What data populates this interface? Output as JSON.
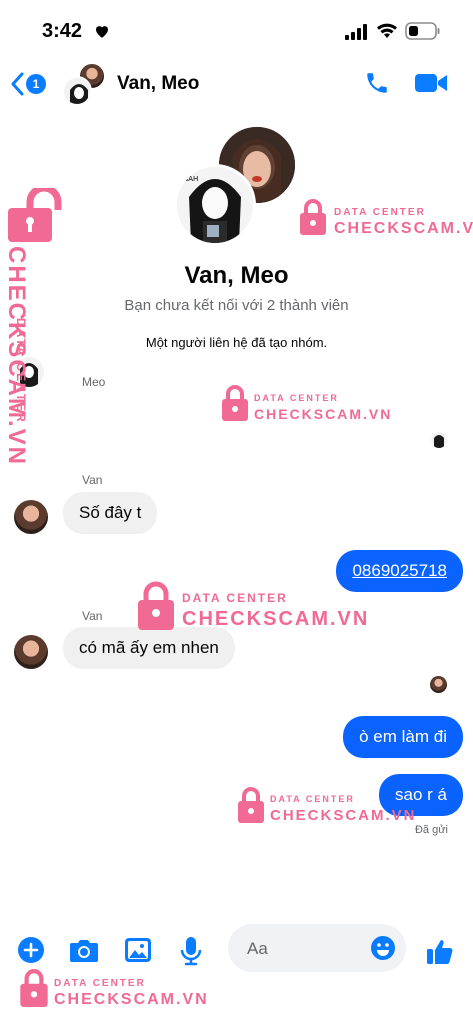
{
  "status_bar": {
    "time": "3:42"
  },
  "header": {
    "title": "Van, Meo",
    "unread_count": "1"
  },
  "group": {
    "name": "Van, Meo",
    "subtitle": "Bạn chưa kết nối với 2 thành viên",
    "system_note": "Một người liên hệ đã tạo nhóm."
  },
  "messages": [
    {
      "sender": "Meo",
      "direction": "incoming",
      "text": ""
    },
    {
      "sender": "Van",
      "direction": "incoming",
      "text": "Số đây t"
    },
    {
      "sender": "",
      "direction": "outgoing",
      "text": "0869025718",
      "is_link": true
    },
    {
      "sender": "Van",
      "direction": "incoming",
      "text": "có mã ấy em nhen"
    },
    {
      "sender": "",
      "direction": "outgoing",
      "text": "ò em làm đi"
    },
    {
      "sender": "",
      "direction": "outgoing",
      "text": "sao r á"
    }
  ],
  "delivery_status": "Đã gửi",
  "composer": {
    "placeholder": "Aa"
  },
  "watermark": {
    "line1": "DATA CENTER",
    "line2": "CHECKSCAM.VN"
  },
  "colors": {
    "accent": "#0a7cff",
    "outgoing_bubble": "#0a62ff",
    "incoming_bubble": "#f0f0f0",
    "watermark": "#f06a94"
  }
}
